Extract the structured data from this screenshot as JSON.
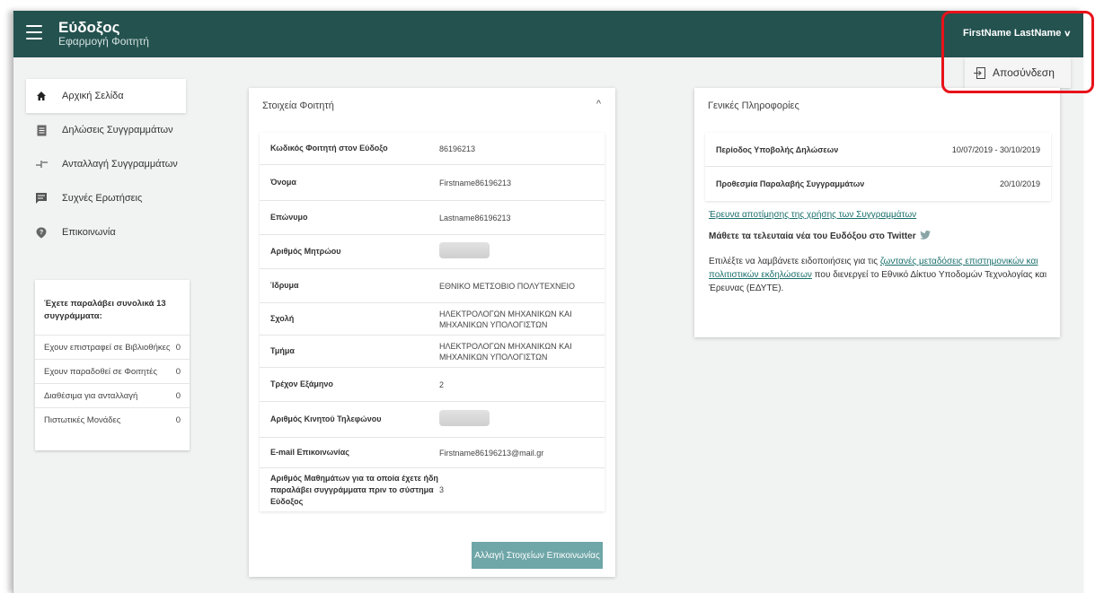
{
  "header": {
    "title": "Εύδοξος",
    "subtitle": "Εφαρμογή Φοιτητή",
    "user_name": "FirstName LastName",
    "user_chevron": "⌄",
    "logout_label": "Αποσύνδεση"
  },
  "sidebar": {
    "items": [
      {
        "label": "Αρχική Σελίδα",
        "icon": "home-icon"
      },
      {
        "label": "Δηλώσεις Συγγραμμάτων",
        "icon": "document-icon"
      },
      {
        "label": "Ανταλλαγή Συγγραμμάτων",
        "icon": "exchange-icon"
      },
      {
        "label": "Συχνές Ερωτήσεις",
        "icon": "faq-icon"
      },
      {
        "label": "Επικοινωνία",
        "icon": "help-icon"
      }
    ]
  },
  "stats": {
    "heading": "Έχετε παραλάβει συνολικά 13 συγγράμματα:",
    "rows": [
      {
        "label": "Εχουν επιστραφεί σε Βιβλιοθήκες",
        "value": "0"
      },
      {
        "label": "Εχουν παραδοθεί σε Φοιτητές",
        "value": "0"
      },
      {
        "label": "Διαθέσιμα για ανταλλαγή",
        "value": "0"
      },
      {
        "label": "Πιστωτικές Μονάδες",
        "value": "0"
      }
    ]
  },
  "student": {
    "title": "Στοιχεία Φοιτητή",
    "collapse_glyph": "^",
    "rows": [
      {
        "label": "Κωδικός Φοιτητή στον Εύδοξο",
        "value": "86196213"
      },
      {
        "label": "Όνομα",
        "value": "Firstname86196213"
      },
      {
        "label": "Επώνυμο",
        "value": "Lastname86196213"
      },
      {
        "label": "Αριθμός Μητρώου",
        "value": ""
      },
      {
        "label": "Ίδρυμα",
        "value": "ΕΘΝΙΚΟ ΜΕΤΣΟΒΙΟ ΠΟΛΥΤΕΧΝΕΙΟ"
      },
      {
        "label": "Σχολή",
        "value": "ΗΛΕΚΤΡΟΛΟΓΩΝ ΜΗΧΑΝΙΚΩΝ ΚΑΙ ΜΗΧΑΝΙΚΩΝ ΥΠΟΛΟΓΙΣΤΩΝ"
      },
      {
        "label": "Τμήμα",
        "value": "ΗΛΕΚΤΡΟΛΟΓΩΝ ΜΗΧΑΝΙΚΩΝ ΚΑΙ ΜΗΧΑΝΙΚΩΝ ΥΠΟΛΟΓΙΣΤΩΝ"
      },
      {
        "label": "Τρέχον Εξάμηνο",
        "value": "2"
      },
      {
        "label": "Αριθμός Κινητού Τηλεφώνου",
        "value": ""
      },
      {
        "label": "E-mail Επικοινωνίας",
        "value": "Firstname86196213@mail.gr"
      },
      {
        "label": "Αριθμός Μαθημάτων για τα οποία έχετε ήδη παραλάβει συγγράμματα πριν το σύστημα Εύδοξος",
        "value": "3"
      }
    ],
    "button_label": "Αλλαγή Στοιχείων Επικοινωνίας"
  },
  "general": {
    "title": "Γενικές Πληροφορίες",
    "rows": [
      {
        "label": "Περίοδος Υποβολής Δηλώσεων",
        "value": "10/07/2019 - 30/10/2019"
      },
      {
        "label": "Προθεσμία Παραλαβής Συγγραμμάτων",
        "value": "20/10/2019"
      }
    ],
    "survey_link": "Έρευνα αποτίμησης της χρήσης των Συγγραμμάτων",
    "twitter_text": "Μάθετε τα τελευταία νέα του Ευδόξου στο Twitter",
    "notify_prefix": "Επιλέξτε να λαμβάνετε ειδοποιήσεις για τις ",
    "notify_link": "ζωντανές μεταδόσεις επιστημονικών και πολιτιστικών εκδηλώσεων",
    "notify_suffix": " που διενεργεί το Εθνικό Δίκτυο Υποδομών Τεχνολογίας και Έρευνας (ΕΔΥΤΕ)."
  },
  "colors": {
    "header_bg": "#24524f",
    "button_bg": "#6fa6a8",
    "link": "#1a6f6c",
    "highlight": "#e8121a"
  }
}
